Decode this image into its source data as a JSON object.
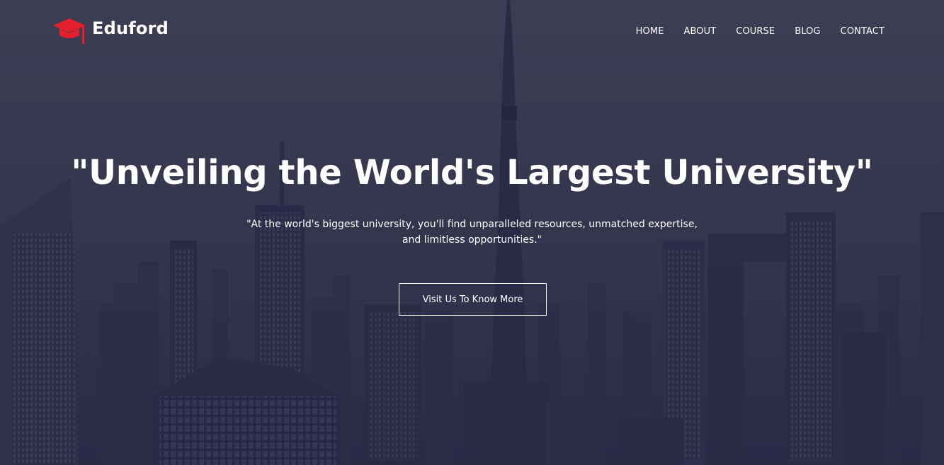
{
  "brand": {
    "name": "Eduford",
    "accent_color": "#e4202c",
    "icon": "graduation-cap-icon"
  },
  "nav": {
    "items": [
      {
        "label": "HOME"
      },
      {
        "label": "ABOUT"
      },
      {
        "label": "COURSE"
      },
      {
        "label": "BLOG"
      },
      {
        "label": "CONTACT"
      }
    ]
  },
  "hero": {
    "headline": "\"Unveiling the World's Largest University\"",
    "subtext": "\"At the world's biggest university, you'll find unparalleled resources, unmatched expertise, and limitless opportunities.\"",
    "cta_label": "Visit Us To Know More",
    "background": "city-skyline-photo"
  }
}
